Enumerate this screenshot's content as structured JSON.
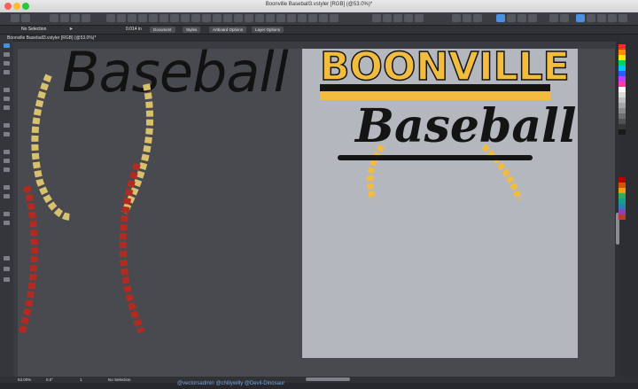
{
  "window": {
    "title": "Boonville Baseball3.vstyler [RGB] (@53.0%)*"
  },
  "context_bar": {
    "selection": "No Selection",
    "angle_value": "0.014 in",
    "buttons": [
      "Document",
      "Styles",
      "Artboard Options",
      "Layer Options"
    ]
  },
  "document_tab": {
    "label": "Boonville Baseball3.vstyler [RGB] (@53.0%)*"
  },
  "canvas": {
    "pasteboard_word": "Baseball",
    "artboard_top_text": "BOONVILLE",
    "artboard_script_text": "Baseball",
    "colors": {
      "gold": "#f2bd3e",
      "red": "#b22a20",
      "tan": "#d8c06d",
      "script": "#141414"
    }
  },
  "status_bar": {
    "zoom": "53.00%",
    "angle": "0.0°",
    "page": "1",
    "selection": "No Selection"
  },
  "credits": "@vectorsadmin @chillywilly @Devil-Dinosaur",
  "icons": {
    "undo": "undo-icon",
    "redo": "redo-icon",
    "arrow": "selection-arrow-icon"
  }
}
